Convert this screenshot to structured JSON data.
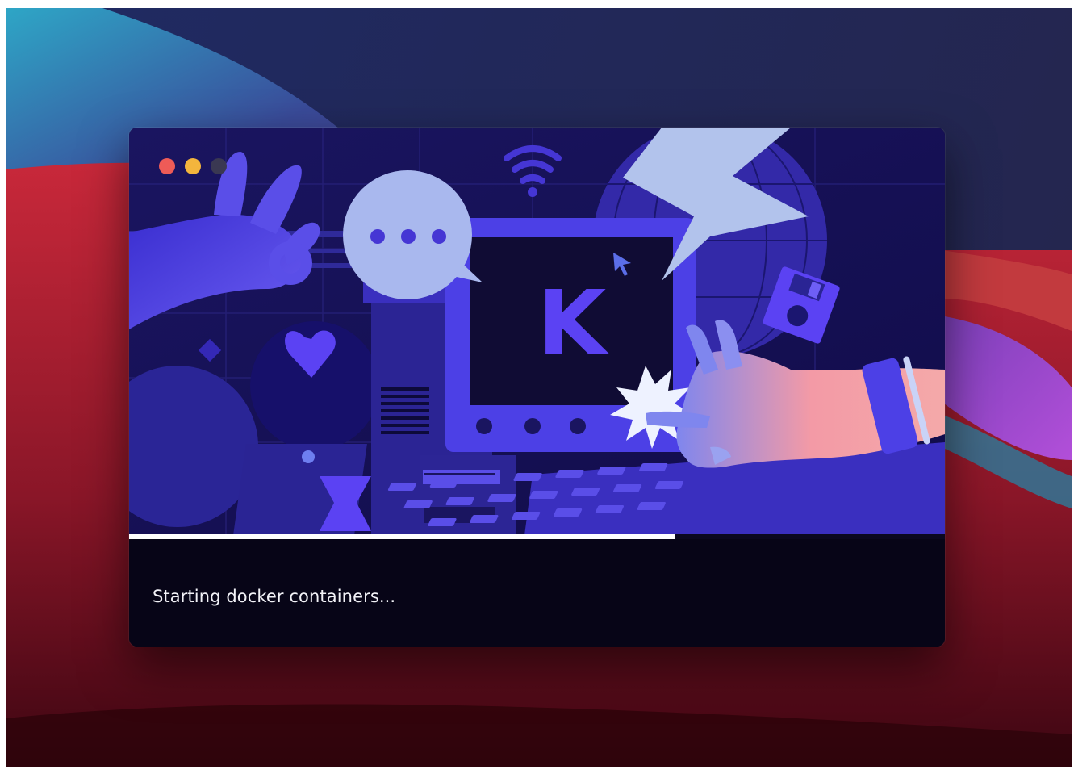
{
  "window": {
    "traffic_lights": [
      {
        "name": "close",
        "color": "#ee5b57"
      },
      {
        "name": "minimize",
        "color": "#f3b53d"
      },
      {
        "name": "zoom",
        "color": "#3a3852"
      }
    ]
  },
  "splash": {
    "logo_letter": "K",
    "progress": 0.67,
    "status": "Starting docker containers..."
  },
  "colors": {
    "accent": "#5b42f3",
    "window_background": "#070517",
    "progress_fill": "#ffffff"
  },
  "icons": [
    "speech-bubble-icon",
    "wifi-icon",
    "lightning-bolt-icon",
    "mouse-cursor-icon",
    "heart-icon",
    "floppy-disk-icon",
    "hourglass-icon",
    "globe-icon"
  ]
}
